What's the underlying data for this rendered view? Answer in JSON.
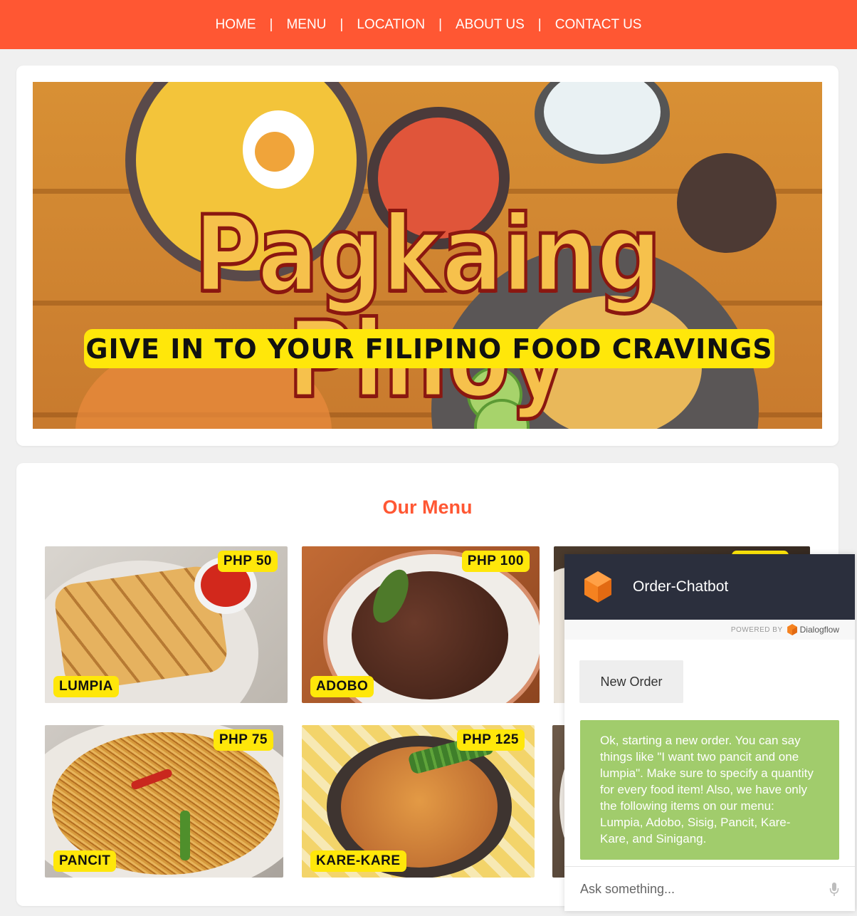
{
  "nav": {
    "items": [
      "HOME",
      "MENU",
      "LOCATION",
      "ABOUT US",
      "CONTACT US"
    ],
    "separator": "|"
  },
  "hero": {
    "title": "Pagkaing Pinoy",
    "tagline": "GIVE IN TO YOUR FILIPINO FOOD CRAVINGS"
  },
  "menu": {
    "title": "Our Menu",
    "items": [
      {
        "name": "LUMPIA",
        "price": "PHP 50"
      },
      {
        "name": "ADOBO",
        "price": "PHP 100"
      },
      {
        "name": "",
        "price": ""
      },
      {
        "name": "PANCIT",
        "price": "PHP 75"
      },
      {
        "name": "KARE-KARE",
        "price": "PHP 125"
      },
      {
        "name": "",
        "price": ""
      }
    ]
  },
  "chat": {
    "title": "Order-Chatbot",
    "powered_by": "POWERED BY",
    "powered_brand": "Dialogflow",
    "user_message": "New Order",
    "bot_message": "Ok, starting a new order. You can say things like \"I want two pancit and one lumpia\". Make sure to specify a quantity for every food item! Also, we have only the following items on our menu: Lumpia, Adobo, Sisig, Pancit, Kare-Kare, and Sinigang.",
    "input_placeholder": "Ask something..."
  },
  "colors": {
    "nav_bg": "#ff5733",
    "accent_yellow": "#ffe70a",
    "chat_header_bg": "#2b2f3d",
    "bot_bubble": "#a1cc6c"
  },
  "icons": [
    "dialogflow-logo-icon",
    "microphone-icon"
  ]
}
